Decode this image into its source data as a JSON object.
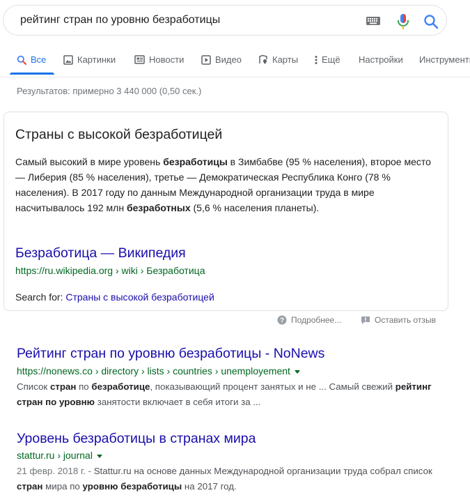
{
  "search": {
    "query": "рейтинг стран по уровню безработицы"
  },
  "tabs": [
    {
      "label": "Все",
      "icon": "search-icon",
      "active": true
    },
    {
      "label": "Картинки",
      "icon": "image-icon"
    },
    {
      "label": "Новости",
      "icon": "news-icon"
    },
    {
      "label": "Видео",
      "icon": "video-icon"
    },
    {
      "label": "Карты",
      "icon": "map-pin-icon"
    },
    {
      "label": "Ещё",
      "icon": "more-vert-icon"
    },
    {
      "label": "Настройки"
    },
    {
      "label": "Инструменты"
    }
  ],
  "stats": "Результатов: примерно 3 440 000 (0,50 сек.)",
  "featured": {
    "title": "Страны с высокой безработицей",
    "p1": "Самый высокий в мире уровень ",
    "b1": "безработицы",
    "p2": " в Зимбабве (95 % населения), второе место — Либерия (85 % населения), третье — Демократическая Республика Конго (78 % населения). В 2017 году по данным Международной организации труда в мире насчитывалось 192 млн ",
    "b2": "безработных",
    "p3": " (5,6 % населения планеты).",
    "link": "Безработица — Википедия",
    "url": "https://ru.wikipedia.org › wiki › Безработица",
    "search_for_label": "Search for:",
    "search_for_link": "Страны с высокой безработицей"
  },
  "feedback": {
    "more": "Подробнее...",
    "review": "Оставить отзыв"
  },
  "results": [
    {
      "title": "Рейтинг стран по уровню безработицы - NoNews",
      "url": "https://nonews.co › directory › lists › countries › unemployement",
      "s1": "Список ",
      "b1": "стран",
      "s2": " по ",
      "b2": "безработице",
      "s3": ", показывающий процент занятых и не ... Самый свежий ",
      "b3": "рейтинг стран по уровню",
      "s4": " занятости включает в себя итоги за ..."
    },
    {
      "title": "Уровень безработицы в странах мира",
      "url": "stattur.ru › journal",
      "date": "21 февр. 2018 г. - ",
      "s1": "Stattur.ru на основе данных Международной организации труда собрал список ",
      "b1": "стран",
      "s2": " мира по ",
      "b2": "уровню безработицы",
      "s3": " на 2017 год."
    }
  ],
  "colors": {
    "link": "#1a0dab",
    "url_green": "#006621",
    "active_tab": "#1a73e8"
  }
}
